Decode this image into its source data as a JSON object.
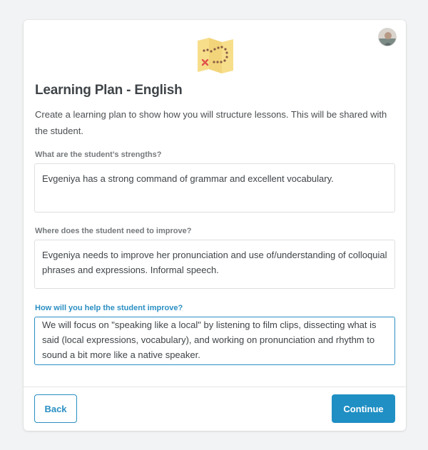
{
  "header": {
    "title": "Learning Plan - English",
    "description": "Create a learning plan to show how you will structure lessons. This will be shared with the student."
  },
  "icons": {
    "avatar": "user-avatar",
    "illustration": "treasure-map-icon"
  },
  "fields": [
    {
      "label": "What are the student’s strengths?",
      "value": "Evgeniya has a strong command of grammar and excellent vocabulary."
    },
    {
      "label": "Where does the student need to improve?",
      "value": "Evgeniya needs to improve her pronunciation and use of/understanding of colloquial phrases and expressions. Informal speech."
    },
    {
      "label": "How will you help the student improve?",
      "value": "We will focus on \"speaking like a local\" by listening to film clips, dissecting what is said (local expressions, vocabulary), and working on pronunciation and rhythm to sound a bit more like a native speaker."
    }
  ],
  "footer": {
    "back_label": "Back",
    "continue_label": "Continue"
  },
  "colors": {
    "accent": "#1f8fc4",
    "map_paper": "#f7de8b",
    "map_path": "#8a5a44",
    "map_x": "#e0534a"
  }
}
